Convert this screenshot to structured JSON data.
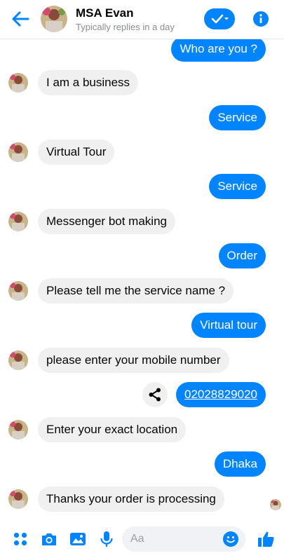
{
  "header": {
    "name": "MSA Evan",
    "status": "Typically replies in a day"
  },
  "messages": [
    {
      "from": "me",
      "text": "Who are you ?"
    },
    {
      "from": "bot",
      "text": "I am a business"
    },
    {
      "from": "me",
      "text": "Service"
    },
    {
      "from": "bot",
      "text": "Virtual Tour"
    },
    {
      "from": "me",
      "text": "Service"
    },
    {
      "from": "bot",
      "text": "Messenger bot making"
    },
    {
      "from": "me",
      "text": "Order"
    },
    {
      "from": "bot",
      "text": "Please tell me the service name ?"
    },
    {
      "from": "me",
      "text": "Virtual tour"
    },
    {
      "from": "bot",
      "text": "please enter your mobile number"
    },
    {
      "from": "me",
      "text": "02028829020",
      "link": true
    },
    {
      "from": "bot",
      "text": "Enter your exact location"
    },
    {
      "from": "me",
      "text": "Dhaka"
    },
    {
      "from": "bot",
      "text": "Thanks your order is processing"
    }
  ],
  "composer": {
    "placeholder": "Aa"
  },
  "icons": {
    "back": "back-arrow-icon",
    "check": "check-icon",
    "info": "info-icon",
    "share": "share-icon",
    "menu": "four-dots-icon",
    "camera": "camera-icon",
    "gallery": "image-icon",
    "mic": "microphone-icon",
    "emoji": "emoji-icon",
    "like": "thumbs-up-icon"
  },
  "colors": {
    "accent": "#0084ff",
    "incoming_bubble": "#f0f0f0",
    "secondary_text": "#8a8d91"
  }
}
